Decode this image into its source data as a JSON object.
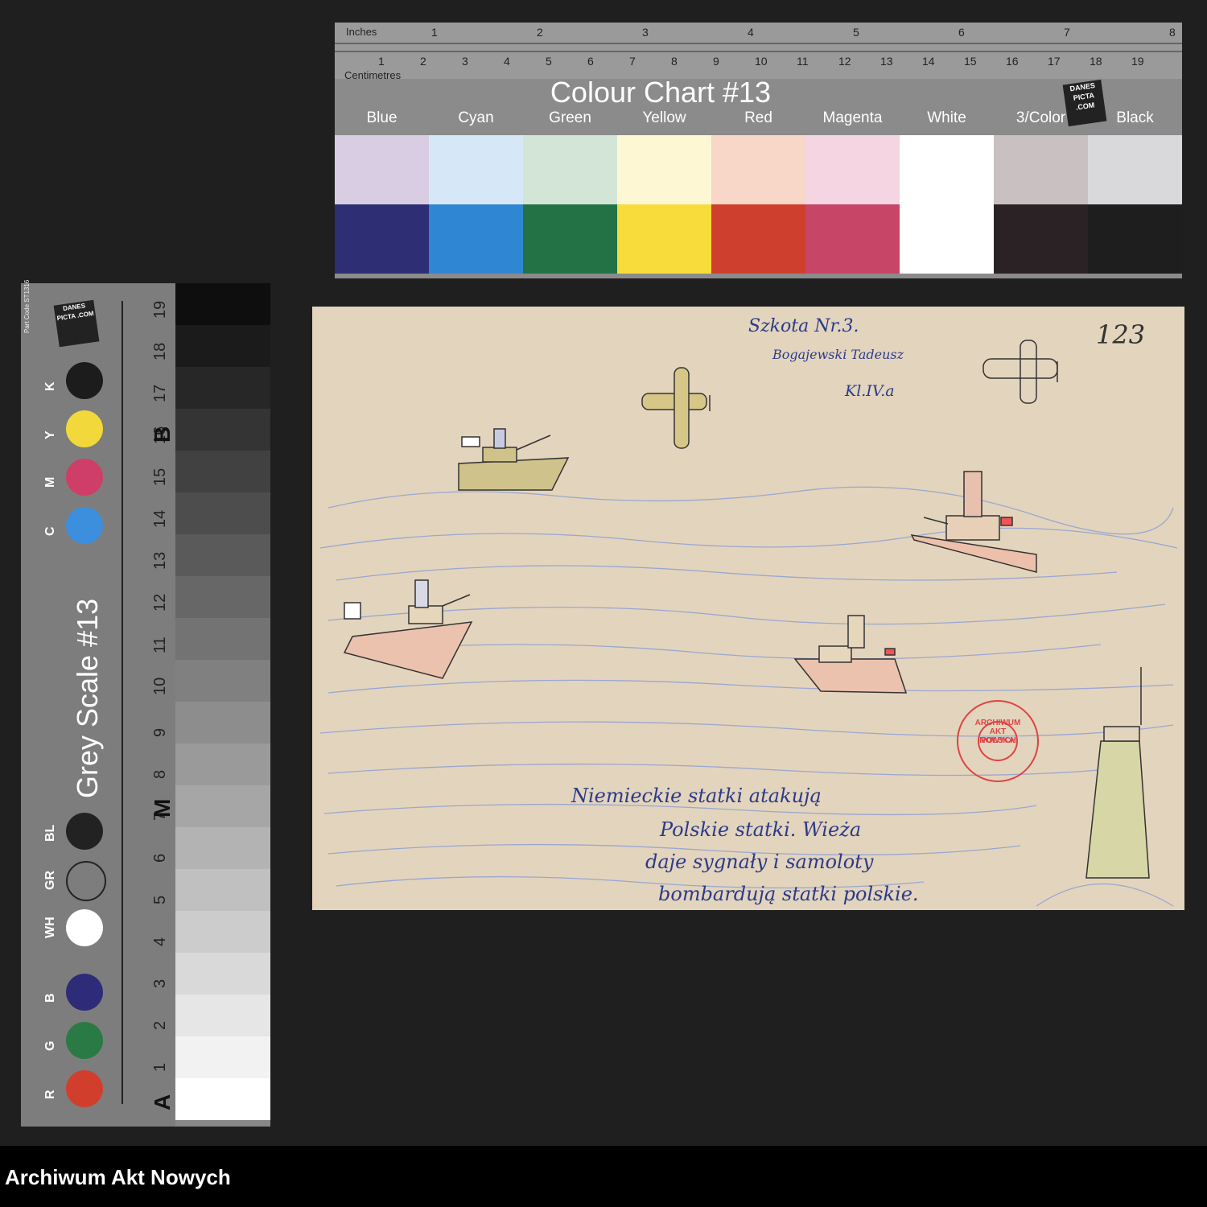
{
  "colour_chart": {
    "title": "Colour Chart #13",
    "ruler": {
      "inches_label": "Inches",
      "centimetres_label": "Centimetres",
      "inch_ticks": [
        "1",
        "2",
        "3",
        "4",
        "5",
        "6",
        "7",
        "8"
      ],
      "cm_ticks": [
        "1",
        "2",
        "3",
        "4",
        "5",
        "6",
        "7",
        "8",
        "9",
        "10",
        "11",
        "12",
        "13",
        "14",
        "15",
        "16",
        "17",
        "18",
        "19"
      ]
    },
    "logo_text": "DANES PICTA .COM",
    "swatches": [
      {
        "label": "Blue",
        "light": "#d8cde3",
        "dark": "#2d2e73"
      },
      {
        "label": "Cyan",
        "light": "#d6e8f7",
        "dark": "#2f86d3"
      },
      {
        "label": "Green",
        "light": "#d2e5d6",
        "dark": "#227245"
      },
      {
        "label": "Yellow",
        "light": "#fdf7d4",
        "dark": "#f7dc3c"
      },
      {
        "label": "Red",
        "light": "#f8d6c8",
        "dark": "#cf3f2d"
      },
      {
        "label": "Magenta",
        "light": "#f6d5e2",
        "dark": "#c74566"
      },
      {
        "label": "White",
        "light": "#ffffff",
        "dark": "#ffffff"
      },
      {
        "label": "3/Color",
        "light": "#c9c0c1",
        "dark": "#2b2225"
      },
      {
        "label": "Black",
        "light": "#d9d9db",
        "dark": "#1e1e1e"
      }
    ]
  },
  "grey_scale": {
    "title": "Grey Scale #13",
    "part_code": "Part Code ST1316",
    "dots": [
      {
        "label": "K",
        "color": "#1c1c1c"
      },
      {
        "label": "Y",
        "color": "#f2d83a"
      },
      {
        "label": "M",
        "color": "#cf3e66"
      },
      {
        "label": "C",
        "color": "#3b8fdc"
      },
      {
        "label": "BL",
        "color": "#222222"
      },
      {
        "label": "GR",
        "color": "#7d7d7d"
      },
      {
        "label": "WH",
        "color": "#ffffff"
      },
      {
        "label": "B",
        "color": "#2e2c78"
      },
      {
        "label": "G",
        "color": "#2a7a45"
      },
      {
        "label": "R",
        "color": "#d13f2c"
      }
    ],
    "letters": [
      "B",
      "M",
      "A"
    ],
    "numbers": [
      "19",
      "18",
      "17",
      "16",
      "15",
      "14",
      "13",
      "12",
      "11",
      "10",
      "9",
      "8",
      "7",
      "6",
      "5",
      "4",
      "3",
      "2",
      "1"
    ]
  },
  "drawing": {
    "header_lines": [
      "Szkota Nr.3.",
      "Bogajewski Tadeusz",
      "Kl.IV.a"
    ],
    "number": "123",
    "stamp_text": "ARCHIWUM AKT NOWYCH",
    "stamp_center": "POLSKA",
    "caption_lines": [
      "Niemieckie statki atakują",
      "Polskie statki. Wieża",
      "daje sygnały i samoloty",
      "bombardują statki polskie."
    ]
  },
  "footer": {
    "label": "Archiwum Akt Nowych"
  }
}
